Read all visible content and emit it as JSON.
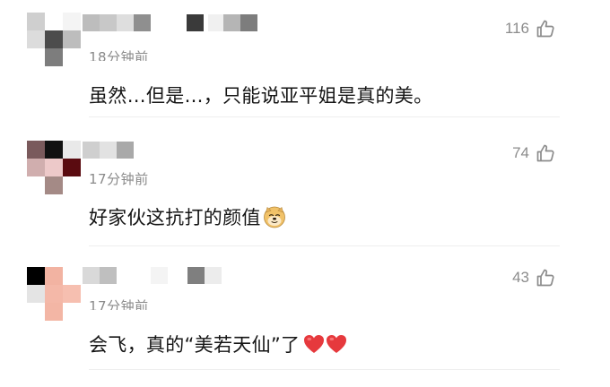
{
  "comments": [
    {
      "time": "18分钟前",
      "text": "虽然…但是…，只能说亚平姐是真的美。",
      "likes": "116",
      "avatar_colors": [
        "#cfcfcf",
        "#ffffff",
        "#f4f4f4",
        "#dcdcdc",
        "#4c4c4c",
        "#bdbdbd",
        "#ffffff",
        "#7d7d7d",
        "#ffffff"
      ],
      "name_colors": [
        "#bdbdbd",
        "#c8c8c8",
        "#dedede",
        "#8f8f8f",
        "#ffffff",
        "#ffffff",
        "#3a3a3a",
        "#f0f0f0",
        "#b5b5b5",
        "#7d7d7d"
      ]
    },
    {
      "time": "17分钟前",
      "text": "好家伙这抗打的颜值",
      "likes": "74",
      "avatar_colors": [
        "#7a5a5c",
        "#111111",
        "#e9e9e9",
        "#d0aeae",
        "#edc9c9",
        "#5a0b10",
        "#ffffff",
        "#a48a86",
        "#ffffff"
      ],
      "name_colors": [
        "#cfcfcf",
        "#e2e2e2",
        "#a9a9a9",
        "#ffffff",
        "#ffffff",
        "#ffffff",
        "#ffffff",
        "#ffffff",
        "#ffffff",
        "#ffffff"
      ]
    },
    {
      "time": "17分钟前",
      "text_before": "会飞，真的“美若天仙”了",
      "likes": "43",
      "avatar_colors": [
        "#000000",
        "#f2b3a2",
        "#ffffff",
        "#e4e4e4",
        "#f4b8a8",
        "#f6bfb0",
        "#ffffff",
        "#f3b6a5",
        "#ffffff"
      ],
      "name_colors": [
        "#d9d9d9",
        "#bfbfbf",
        "#ffffff",
        "#ffffff",
        "#f4f4f4",
        "#ffffff",
        "#7f7f7f",
        "#ececec",
        "#ffffff",
        "#ffffff"
      ]
    }
  ],
  "icons": {
    "like": "thumbs-up-icon",
    "emoji_1": "doge-icon",
    "emoji_2": "red-heart-icon"
  },
  "colors": {
    "text": "#151515",
    "meta": "#8a8a8a",
    "like": "#8c8c8c",
    "heart": "#e6393d"
  }
}
